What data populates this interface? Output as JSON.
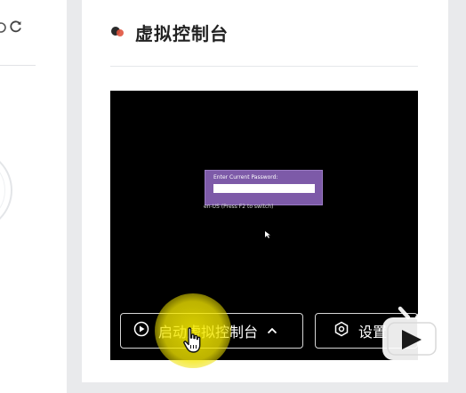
{
  "left_panel": {
    "refresh_icon": "refresh-icon",
    "partial_icon": "sync-icon"
  },
  "card": {
    "title": "虚拟控制台",
    "title_icon": "status-dot-icon"
  },
  "console": {
    "password_prompt": "Enter Current Password:",
    "keyboard_hint": "en-US (Press F2 to switch)",
    "background": "#000000",
    "dialog_color": "#7d5aa8"
  },
  "toolbar": {
    "launch_label": "启动虚拟控制台",
    "launch_icon": "play-circle-icon",
    "launch_chevron": "chevron-up-icon",
    "settings_label": "设置",
    "settings_icon": "hexagon-settings-icon"
  },
  "overlay": {
    "highlight_color": "#f5e800",
    "cursor": "hand-pointer-icon",
    "watermark": "bilibili-tv-icon"
  }
}
